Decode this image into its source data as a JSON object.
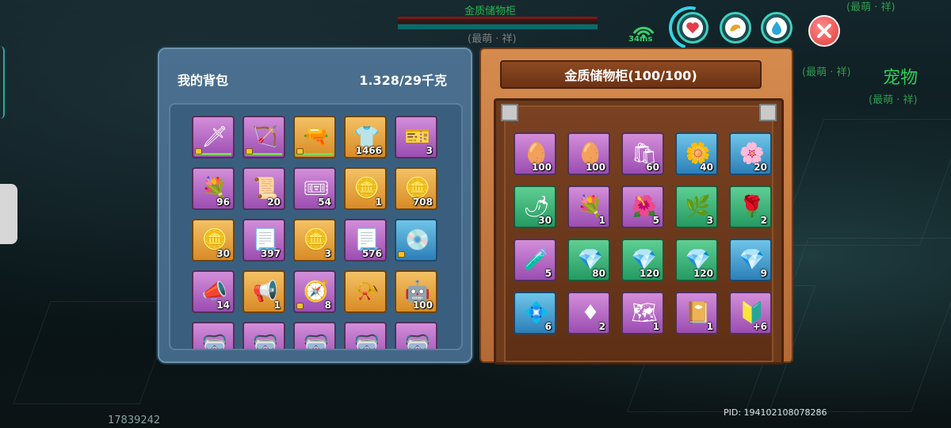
{
  "scene": {
    "top_title": "金质储物柜",
    "top_sub": "(最萌 · 祥)",
    "npc_texts": [
      {
        "text": "(最萌 · 祥)",
        "kind": "sub"
      },
      {
        "text": "(最萌 · 祥)",
        "kind": "sub"
      },
      {
        "text": "宠物",
        "kind": "big"
      },
      {
        "text": "(最萌 · 祥)",
        "kind": "sub"
      }
    ],
    "footer_left": "17839242",
    "pid": "PID: 194102108078286"
  },
  "hud": {
    "ping": "34ms",
    "buttons": [
      "heart-icon",
      "hand-icon",
      "water-drop-icon"
    ],
    "colors": {
      "ring": "#3fcfbf",
      "close": "#e03a3a"
    }
  },
  "backpack": {
    "title": "我的背包",
    "weight": "1.328/29千克",
    "slots": [
      {
        "name": "sword-icon",
        "glyph": "🗡",
        "color": "purple",
        "count": "",
        "lock": true,
        "bar": true
      },
      {
        "name": "bow-icon",
        "glyph": "🏹",
        "color": "purple",
        "count": "",
        "lock": true,
        "bar": true
      },
      {
        "name": "rifle-icon",
        "glyph": "🔫",
        "color": "gold",
        "count": "",
        "lock": true,
        "bar": true
      },
      {
        "name": "tshirt-icon",
        "glyph": "👕",
        "color": "gold",
        "count": "1466",
        "lock": false,
        "bar": false
      },
      {
        "name": "ticket-icon",
        "glyph": "🎫",
        "color": "purple",
        "count": "3",
        "lock": false,
        "bar": false
      },
      {
        "name": "wreath-icon",
        "glyph": "💐",
        "color": "purple",
        "count": "96",
        "lock": false,
        "bar": false
      },
      {
        "name": "scroll-icon",
        "glyph": "📜",
        "color": "purple",
        "count": "20",
        "lock": false,
        "bar": false
      },
      {
        "name": "card-icon",
        "glyph": "🎟",
        "color": "purple",
        "count": "54",
        "lock": false,
        "bar": false
      },
      {
        "name": "gold-coin-icon",
        "glyph": "🪙",
        "color": "gold",
        "count": "1",
        "lock": false,
        "bar": false
      },
      {
        "name": "gold-coin-icon",
        "glyph": "🪙",
        "color": "gold",
        "count": "708",
        "lock": false,
        "bar": false
      },
      {
        "name": "gold-coin-icon",
        "glyph": "🪙",
        "color": "gold",
        "count": "30",
        "lock": false,
        "bar": false
      },
      {
        "name": "wanted-poster-icon",
        "glyph": "📃",
        "color": "purple",
        "count": "397",
        "lock": false,
        "bar": false
      },
      {
        "name": "gold-coin-icon",
        "glyph": "🪙",
        "color": "gold",
        "count": "3",
        "lock": false,
        "bar": false
      },
      {
        "name": "wanted-poster-icon",
        "glyph": "📃",
        "color": "purple",
        "count": "576",
        "lock": false,
        "bar": false
      },
      {
        "name": "disc-icon",
        "glyph": "💿",
        "color": "blue",
        "count": "",
        "lock": true,
        "bar": false
      },
      {
        "name": "megaphone-icon",
        "glyph": "📣",
        "color": "purple",
        "count": "14",
        "lock": false,
        "bar": false
      },
      {
        "name": "loudspeaker-icon",
        "glyph": "📢",
        "color": "gold",
        "count": "1",
        "lock": false,
        "bar": false
      },
      {
        "name": "compass-icon",
        "glyph": "🧭",
        "color": "purple",
        "count": "8",
        "lock": true,
        "bar": false
      },
      {
        "name": "horn-icon",
        "glyph": "📯",
        "color": "gold",
        "count": "",
        "lock": false,
        "bar": false
      },
      {
        "name": "robot-icon",
        "glyph": "🤖",
        "color": "gold",
        "count": "100",
        "lock": false,
        "bar": false
      },
      {
        "name": "goggles-icon",
        "glyph": "🥽",
        "color": "purple",
        "count": "",
        "lock": true,
        "bar": false
      },
      {
        "name": "goggles-icon",
        "glyph": "🥽",
        "color": "purple",
        "count": "",
        "lock": true,
        "bar": false
      },
      {
        "name": "goggles-icon",
        "glyph": "🥽",
        "color": "purple",
        "count": "",
        "lock": true,
        "bar": false
      },
      {
        "name": "goggles-icon",
        "glyph": "🥽",
        "color": "purple",
        "count": "",
        "lock": true,
        "bar": false
      },
      {
        "name": "goggles-icon",
        "glyph": "🥽",
        "color": "purple",
        "count": "",
        "lock": true,
        "bar": false
      }
    ]
  },
  "storage": {
    "title": "金质储物柜(100/100)",
    "slots": [
      {
        "name": "golden-egg-icon",
        "glyph": "🥚",
        "color": "purple",
        "count": "100"
      },
      {
        "name": "golden-egg-icon",
        "glyph": "🥚",
        "color": "purple",
        "count": "100"
      },
      {
        "name": "feed-bag-icon",
        "glyph": "🛍",
        "color": "purple",
        "count": "60"
      },
      {
        "name": "white-flower-icon",
        "glyph": "🌼",
        "color": "blue",
        "count": "40"
      },
      {
        "name": "pink-flower-icon",
        "glyph": "🌸",
        "color": "blue",
        "count": "20"
      },
      {
        "name": "seed-bag-icon",
        "glyph": "🌶",
        "color": "green",
        "count": "30"
      },
      {
        "name": "seed-bag-icon",
        "glyph": "💐",
        "color": "purple",
        "count": "1"
      },
      {
        "name": "seed-bag-icon",
        "glyph": "🌺",
        "color": "purple",
        "count": "5"
      },
      {
        "name": "seed-bag-icon",
        "glyph": "🌿",
        "color": "green",
        "count": "3"
      },
      {
        "name": "seed-bag-icon",
        "glyph": "🌹",
        "color": "green",
        "count": "2"
      },
      {
        "name": "potion-icon",
        "glyph": "🧪",
        "color": "purple",
        "count": "5"
      },
      {
        "name": "red-crystal-icon",
        "glyph": "💎",
        "color": "green",
        "count": "80"
      },
      {
        "name": "yellow-crystal-icon",
        "glyph": "💎",
        "color": "green",
        "count": "120"
      },
      {
        "name": "blue-crystal-icon",
        "glyph": "💎",
        "color": "green",
        "count": "120"
      },
      {
        "name": "red-crystal-icon",
        "glyph": "💎",
        "color": "blue",
        "count": "9"
      },
      {
        "name": "blue-crystal-icon",
        "glyph": "💠",
        "color": "blue",
        "count": "6"
      },
      {
        "name": "ruby-icon",
        "glyph": "♦",
        "color": "purple",
        "count": "2"
      },
      {
        "name": "map-scroll-icon",
        "glyph": "🗺",
        "color": "purple",
        "count": "1"
      },
      {
        "name": "book-icon",
        "glyph": "📔",
        "color": "purple",
        "count": "1"
      },
      {
        "name": "emblem-icon",
        "glyph": "🔰",
        "color": "purple",
        "count": "+6"
      }
    ]
  }
}
